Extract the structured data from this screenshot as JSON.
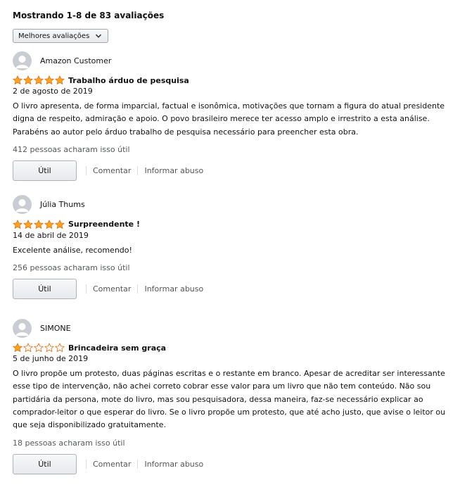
{
  "header": {
    "summary": "Mostrando 1-8 de 83 avaliações",
    "sort_label": "Melhores avaliações"
  },
  "colors": {
    "star_fill": "#ffa41c",
    "star_outline": "#de7921",
    "avatar_bg": "#c9cdd2",
    "muted_text": "#565959"
  },
  "icons": {
    "avatar": "default-profile-icon",
    "star_full": "star-filled-icon",
    "star_empty": "star-empty-icon",
    "sort": "chevron-down-icon"
  },
  "reviews": [
    {
      "author": "Amazon Customer",
      "rating": 5,
      "title": "Trabalho árduo de pesquisa",
      "date": "2 de agosto de 2019",
      "body": "O livro apresenta, de forma imparcial, factual e isonômica, motivações que tornam a figura do atual presidente digna de respeito, admiração e apoio. O povo brasileiro merece ter acesso amplo e irrestrito a esta análise. Parabéns ao autor pelo árduo trabalho de pesquisa necessário para preencher esta obra.",
      "helpful": "412 pessoas acharam isso útil",
      "btn_util": "Útil",
      "comment": "Comentar",
      "report": "Informar abuso"
    },
    {
      "author": "Júlia Thums",
      "rating": 5,
      "title": "Surpreendente !",
      "date": "14 de abril de 2019",
      "body": "Excelente análise, recomendo!",
      "helpful": "256 pessoas acharam isso útil",
      "btn_util": "Útil",
      "comment": "Comentar",
      "report": "Informar abuso"
    },
    {
      "author": "SIMONE",
      "rating": 1,
      "title": "Brincadeira sem graça",
      "date": "5 de junho de 2019",
      "body": "O livro propõe um protesto, duas páginas escritas e o restante em branco. Apesar de acreditar ser interessante esse tipo de intervenção, não achei correto cobrar esse valor para um livro que não tem conteúdo. Não sou partidária da persona, mote do livro, mas sou pesquisadora, dessa maneira, faz-se necessário explicar ao comprador-leitor o que esperar do livro. Se o livro propõe um protesto, que até acho justo, que avise o leitor ou que seja disponibilizado gratuitamente.",
      "helpful": "18 pessoas acharam isso útil",
      "btn_util": "Útil",
      "comment": "Comentar",
      "report": "Informar abuso"
    }
  ]
}
